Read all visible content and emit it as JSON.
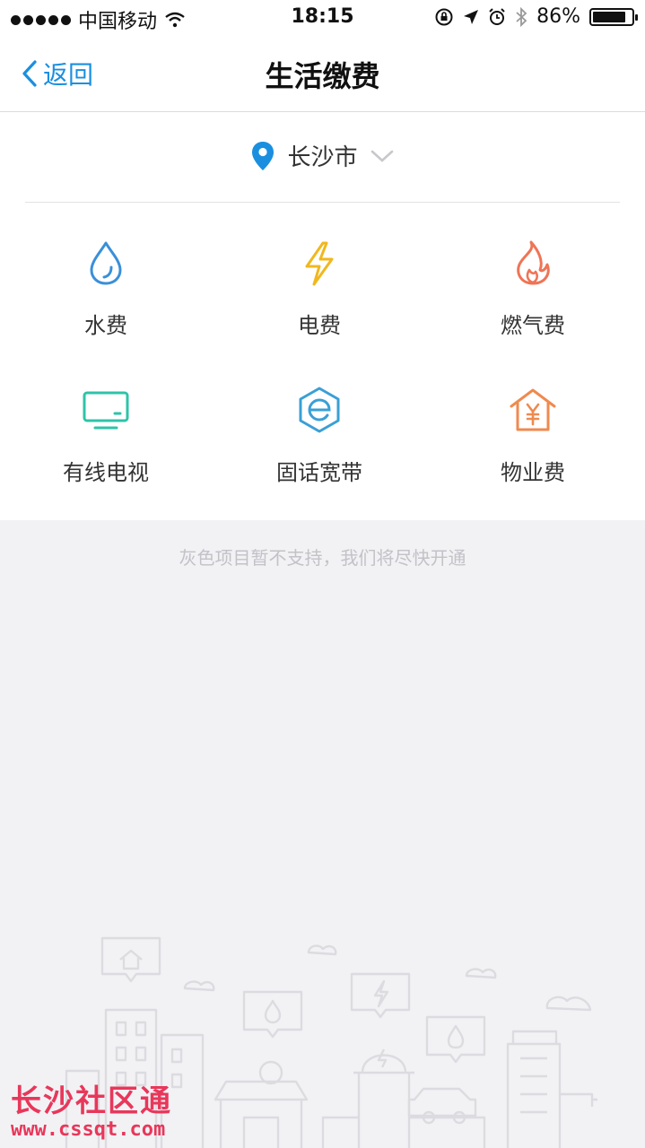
{
  "status": {
    "carrier": "中国移动",
    "time": "18:15",
    "battery": "86%",
    "battery_level": 0.86
  },
  "nav": {
    "back_label": "返回",
    "title": "生活缴费"
  },
  "location": {
    "city": "长沙市"
  },
  "services": [
    {
      "label": "水费",
      "icon": "water-drop-icon",
      "color": "#3a8fd9"
    },
    {
      "label": "电费",
      "icon": "lightning-icon",
      "color": "#f0b81e"
    },
    {
      "label": "燃气费",
      "icon": "flame-icon",
      "color": "#ef7456"
    },
    {
      "label": "有线电视",
      "icon": "tv-icon",
      "color": "#2ec3a8"
    },
    {
      "label": "固话宽带",
      "icon": "broadband-icon",
      "color": "#3a9fd6"
    },
    {
      "label": "物业费",
      "icon": "house-yuan-icon",
      "color": "#ef8a4f"
    }
  ],
  "notice": "灰色项目暂不支持，我们将尽快开通",
  "watermark": {
    "title": "长沙社区通",
    "url": "www.cssqt.com"
  },
  "colors": {
    "accent": "#1a8fe0",
    "background": "#f2f2f5"
  }
}
